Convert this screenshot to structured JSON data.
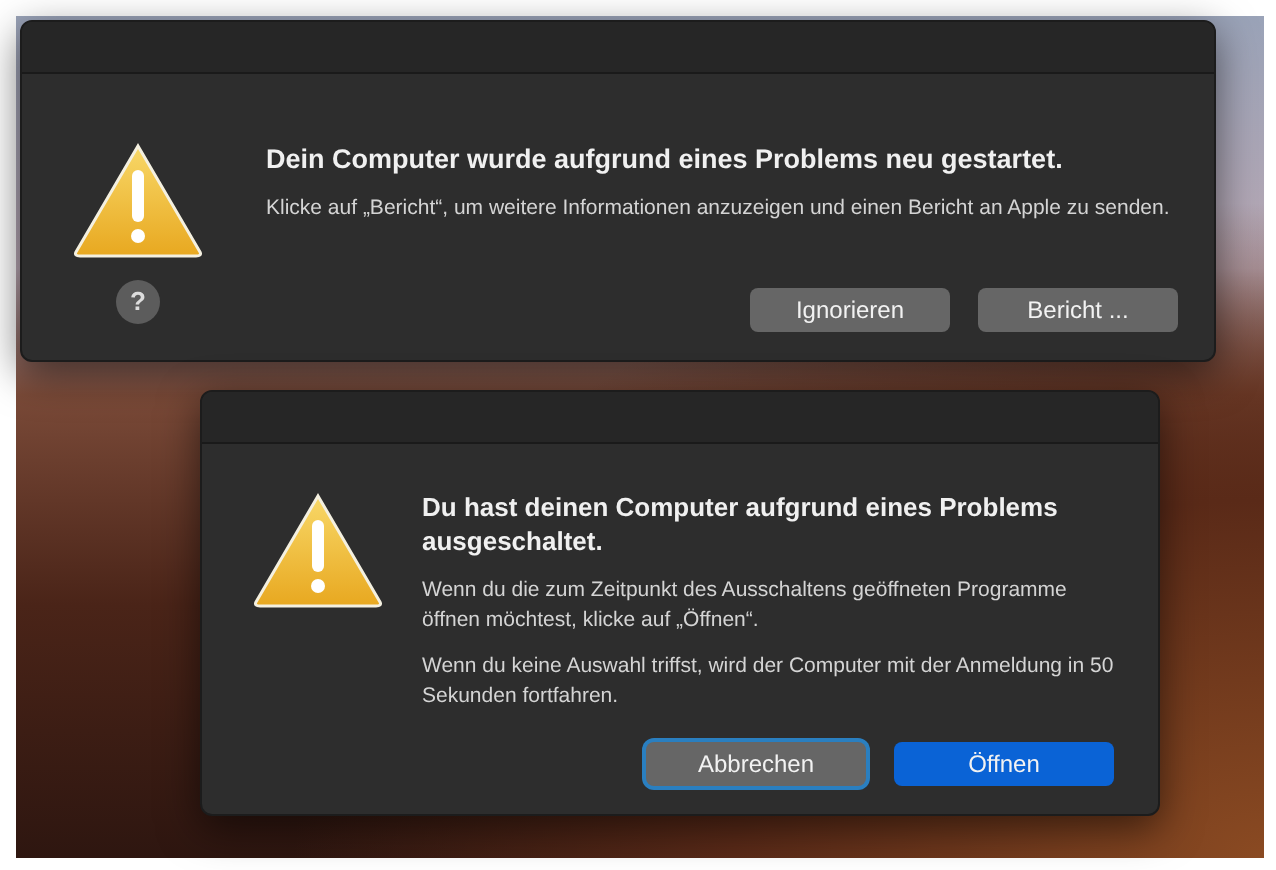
{
  "dialogs": [
    {
      "title": "Dein Computer wurde aufgrund eines Problems neu gestartet.",
      "paragraphs": [
        "Klicke auf „Bericht“, um weitere Informationen anzuzeigen und einen Bericht an Apple zu senden."
      ],
      "help_button": "?",
      "buttons": [
        {
          "label": "Ignorieren",
          "kind": "normal",
          "focused": false
        },
        {
          "label": "Bericht ...",
          "kind": "normal",
          "focused": false
        }
      ]
    },
    {
      "title": "Du hast deinen Computer aufgrund eines Problems ausgeschaltet.",
      "paragraphs": [
        "Wenn du die zum Zeitpunkt des Ausschaltens geöffneten Programme öffnen möchtest, klicke auf „Öffnen“.",
        "Wenn du keine Auswahl triffst, wird der Computer mit der Anmeldung in 50 Sekunden fortfahren."
      ],
      "buttons": [
        {
          "label": "Abbrechen",
          "kind": "normal",
          "focused": true
        },
        {
          "label": "Öffnen",
          "kind": "default",
          "focused": false
        }
      ]
    }
  ]
}
